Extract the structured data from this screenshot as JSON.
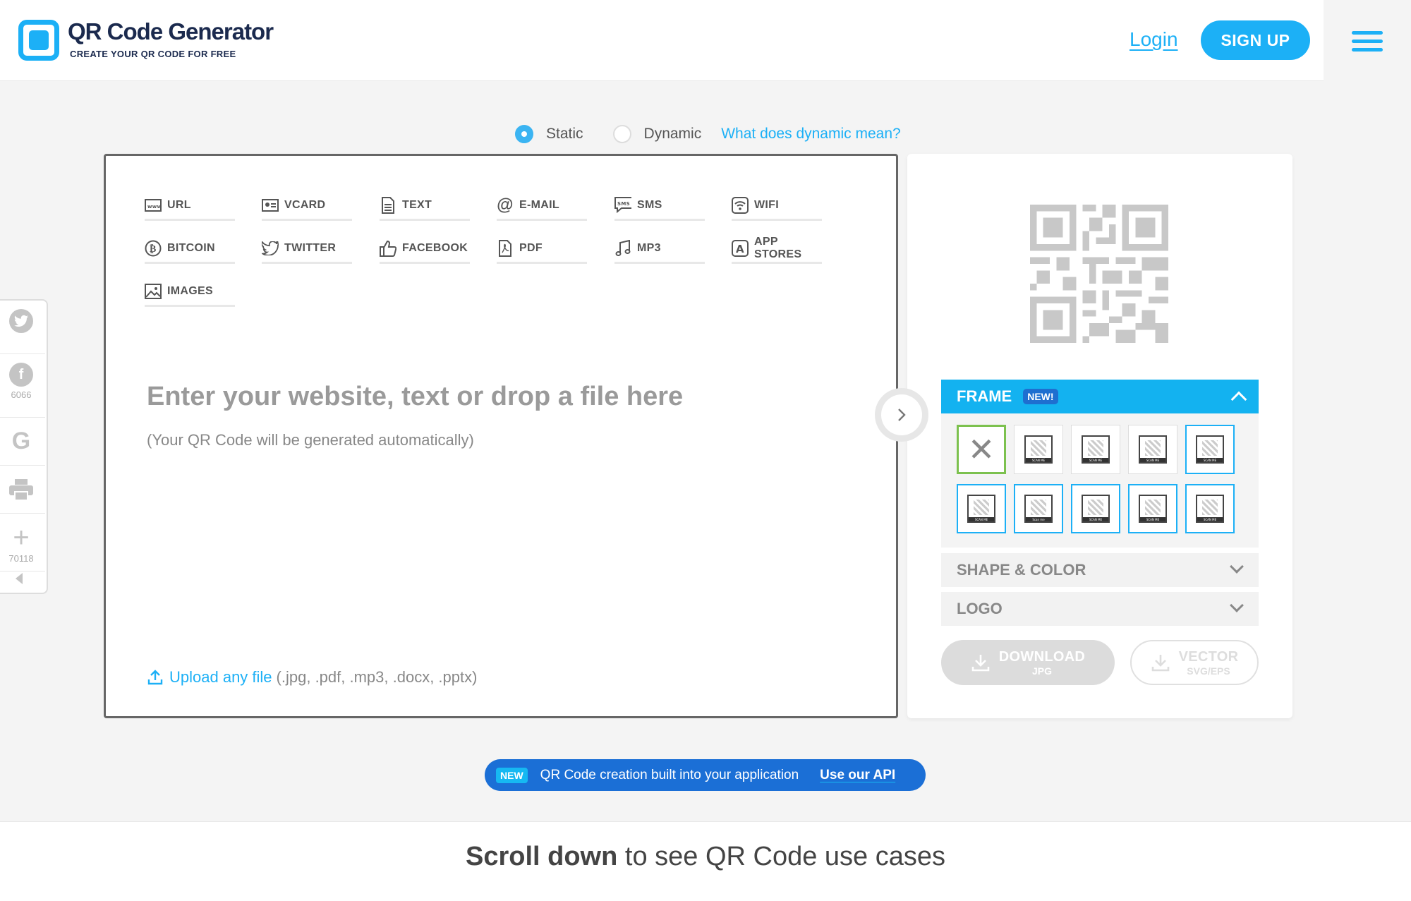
{
  "header": {
    "title": "QR Code Generator",
    "subtitle": "CREATE YOUR QR CODE FOR FREE",
    "login": "Login",
    "signup": "SIGN UP"
  },
  "type_toggle": {
    "static": "Static",
    "dynamic": "Dynamic",
    "help_link": "What does dynamic mean?",
    "selected": "Static"
  },
  "content_types": [
    {
      "label": "URL",
      "icon": "www-icon"
    },
    {
      "label": "VCARD",
      "icon": "vcard-icon"
    },
    {
      "label": "TEXT",
      "icon": "document-icon"
    },
    {
      "label": "E-MAIL",
      "icon": "at-icon"
    },
    {
      "label": "SMS",
      "icon": "sms-icon"
    },
    {
      "label": "WIFI",
      "icon": "wifi-icon"
    },
    {
      "label": "BITCOIN",
      "icon": "bitcoin-icon"
    },
    {
      "label": "TWITTER",
      "icon": "twitter-icon"
    },
    {
      "label": "FACEBOOK",
      "icon": "thumbs-up-icon"
    },
    {
      "label": "PDF",
      "icon": "pdf-icon"
    },
    {
      "label": "MP3",
      "icon": "music-icon"
    },
    {
      "label": "APP STORES",
      "icon": "app-store-icon"
    },
    {
      "label": "IMAGES",
      "icon": "image-icon"
    }
  ],
  "main": {
    "placeholder": "Enter your website, text or drop a file here",
    "note": "(Your QR Code will be generated automatically)",
    "upload_link": "Upload any file",
    "upload_formats": "(.jpg, .pdf, .mp3, .docx, .pptx)"
  },
  "customize": {
    "frame_label": "FRAME",
    "frame_badge": "NEW!",
    "shape_label": "SHAPE & COLOR",
    "logo_label": "LOGO",
    "frame_mini_labels": [
      "SCAN ME",
      "SCAN ME",
      "SCAN ME",
      "SCAN ME",
      "SCAN ME",
      "Scan me",
      "SCAN ME",
      "SCAN ME",
      "SCAN ME"
    ],
    "download_label": "DOWNLOAD",
    "download_sub": "JPG",
    "vector_label": "VECTOR",
    "vector_sub": "SVG/EPS"
  },
  "share": {
    "facebook_count": "6066",
    "plus_count": "70118"
  },
  "api_banner": {
    "badge": "NEW",
    "text": "QR Code creation built into your application",
    "link": "Use our API"
  },
  "footer": {
    "bold": "Scroll down",
    "rest": " to see QR Code use cases"
  },
  "colors": {
    "accent": "#1cb0f6",
    "brand_dark": "#1b2a4e",
    "api_blue": "#1b6fd6",
    "frame_selected": "#7cc14e"
  }
}
